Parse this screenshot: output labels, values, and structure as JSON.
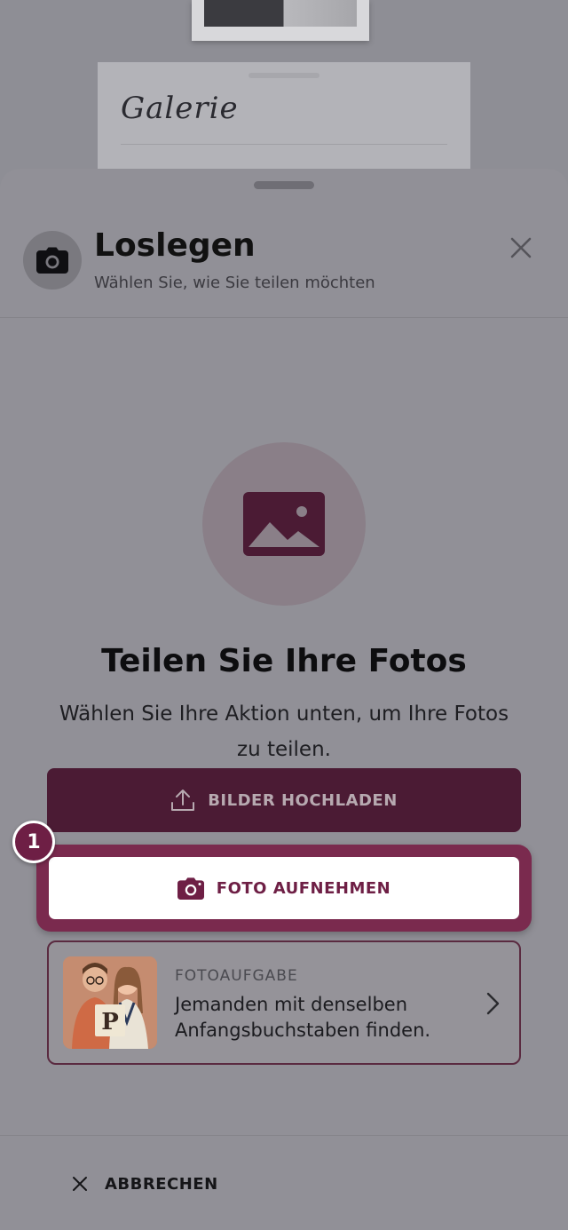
{
  "background": {
    "gallery_title": "Galerie"
  },
  "sheet": {
    "header": {
      "title": "Loslegen",
      "subtitle": "Wählen Sie, wie Sie teilen möchten",
      "icon": "camera-icon",
      "close_icon": "close-icon"
    },
    "hero": {
      "icon": "image-icon",
      "title": "Teilen Sie Ihre Fotos",
      "description": "Wählen Sie Ihre Aktion unten, um Ihre Fotos zu teilen."
    },
    "actions": {
      "upload_label": "BILDER HOCHLADEN",
      "upload_icon": "upload-icon",
      "photo_label": "FOTO AUFNEHMEN",
      "photo_icon": "camera-icon"
    },
    "step_badge": "1",
    "task": {
      "kicker": "FOTOAUFGABE",
      "text": "Jemanden mit denselben Anfangsbuchstaben finden.",
      "thumbnail_letter": "P",
      "chevron_icon": "chevron-right-icon"
    },
    "footer": {
      "cancel_label": "ABBRECHEN",
      "cancel_icon": "close-icon"
    }
  },
  "colors": {
    "brand": "#4b1b34",
    "accent": "#6e1f45",
    "overlay": "#919097"
  }
}
